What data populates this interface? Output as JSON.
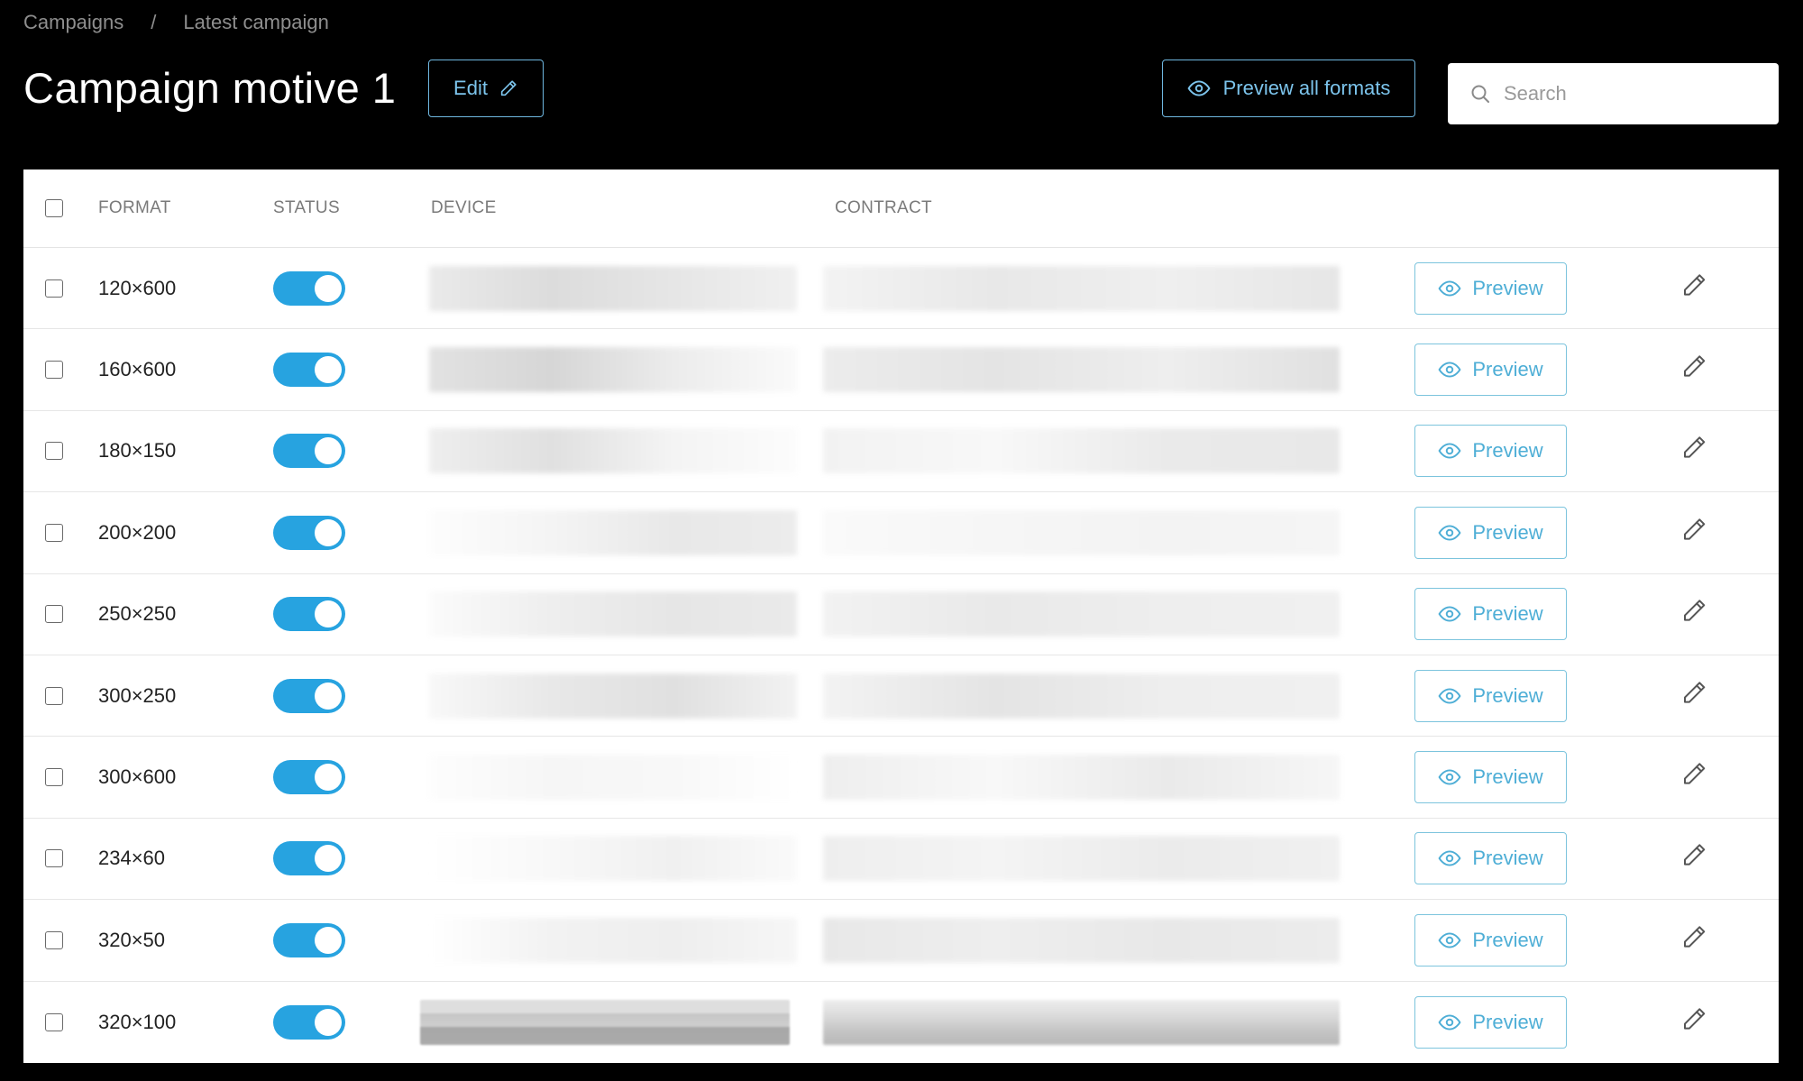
{
  "breadcrumb": {
    "items": [
      "Campaigns",
      "Latest campaign"
    ],
    "separator": "/"
  },
  "header": {
    "title": "Campaign motive 1",
    "edit_label": "Edit",
    "preview_all_label": "Preview all formats"
  },
  "search": {
    "placeholder": "Search",
    "value": ""
  },
  "table": {
    "columns": {
      "format": "FORMAT",
      "status": "STATUS",
      "device": "DEVICE",
      "contract": "CONTRACT"
    },
    "preview_label": "Preview",
    "rows": [
      {
        "format": "120×600",
        "status_on": true
      },
      {
        "format": "160×600",
        "status_on": true
      },
      {
        "format": "180×150",
        "status_on": true
      },
      {
        "format": "200×200",
        "status_on": true
      },
      {
        "format": "250×250",
        "status_on": true
      },
      {
        "format": "300×250",
        "status_on": true
      },
      {
        "format": "300×600",
        "status_on": true
      },
      {
        "format": "234×60",
        "status_on": true
      },
      {
        "format": "320×50",
        "status_on": true
      },
      {
        "format": "320×100",
        "status_on": true
      }
    ]
  },
  "colors": {
    "accent": "#27a3e0",
    "background": "#000000",
    "preview_text": "#4eaed6"
  },
  "icons": {
    "edit": "pencil-icon",
    "preview": "eye-icon",
    "search": "search-icon"
  }
}
